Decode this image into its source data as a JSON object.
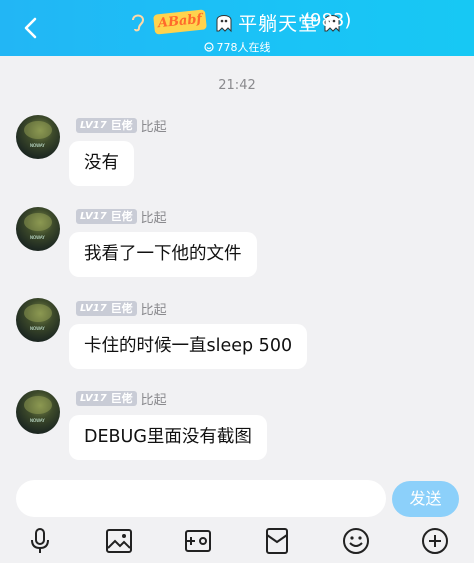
{
  "header": {
    "title": "平躺天堂",
    "member_count": "(983)",
    "online_text": "778人在线",
    "badge_text": "ABabf",
    "accent": "#1bbef6"
  },
  "conversation": {
    "timestamp": "21:42",
    "messages": [
      {
        "level": "LV17",
        "rank": "巨佬",
        "nickname": "比起",
        "text": "没有"
      },
      {
        "level": "LV17",
        "rank": "巨佬",
        "nickname": "比起",
        "text": "我看了一下他的文件"
      },
      {
        "level": "LV17",
        "rank": "巨佬",
        "nickname": "比起",
        "text": "卡住的时候一直sleep 500"
      },
      {
        "level": "LV17",
        "rank": "巨佬",
        "nickname": "比起",
        "text": "DEBUG里面没有截图"
      }
    ]
  },
  "composer": {
    "input_value": "",
    "send_label": "发送",
    "send_color": "#8cd0fa"
  },
  "toolbar": {
    "icons": [
      "microphone-icon",
      "image-icon",
      "video-camera-icon",
      "red-packet-icon",
      "emoji-icon",
      "plus-icon"
    ]
  }
}
